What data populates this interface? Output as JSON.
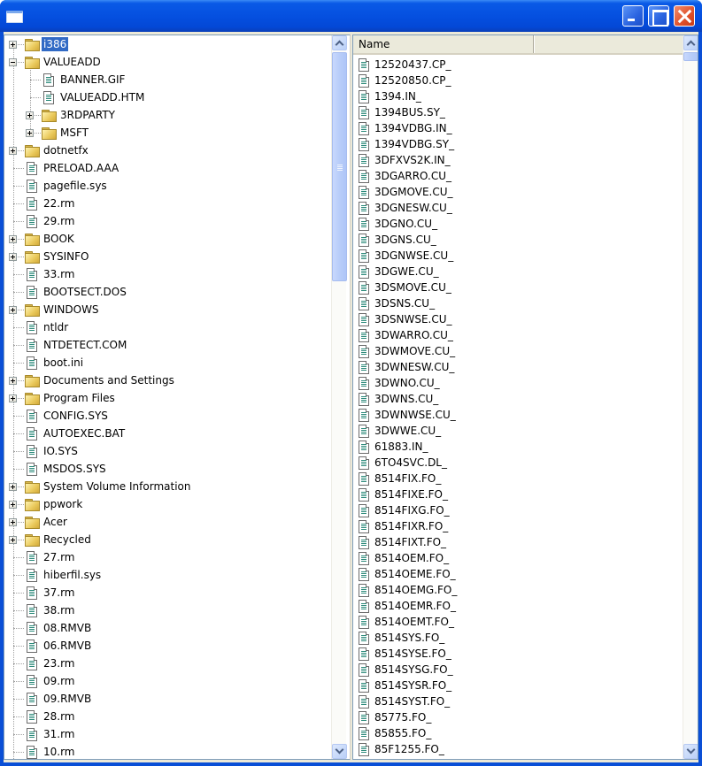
{
  "window": {
    "title": "",
    "buttons": {
      "minimize": "minimize",
      "maximize": "maximize",
      "close": "close"
    }
  },
  "tree": {
    "items": [
      {
        "label": "i386",
        "type": "folder",
        "level": 0,
        "expander": "plus",
        "selected": true
      },
      {
        "label": "VALUEADD",
        "type": "folder",
        "level": 0,
        "expander": "minus"
      },
      {
        "label": "BANNER.GIF",
        "type": "file",
        "level": 1
      },
      {
        "label": "VALUEADD.HTM",
        "type": "file",
        "level": 1
      },
      {
        "label": "3RDPARTY",
        "type": "folder",
        "level": 1,
        "expander": "plus"
      },
      {
        "label": "MSFT",
        "type": "folder",
        "level": 1,
        "expander": "plus"
      },
      {
        "label": "dotnetfx",
        "type": "folder",
        "level": 0,
        "expander": "plus"
      },
      {
        "label": "PRELOAD.AAA",
        "type": "file",
        "level": 0
      },
      {
        "label": "pagefile.sys",
        "type": "file",
        "level": 0
      },
      {
        "label": "22.rm",
        "type": "file",
        "level": 0
      },
      {
        "label": "29.rm",
        "type": "file",
        "level": 0
      },
      {
        "label": "BOOK",
        "type": "folder",
        "level": 0,
        "expander": "plus"
      },
      {
        "label": "SYSINFO",
        "type": "folder",
        "level": 0,
        "expander": "plus"
      },
      {
        "label": "33.rm",
        "type": "file",
        "level": 0
      },
      {
        "label": "BOOTSECT.DOS",
        "type": "file",
        "level": 0
      },
      {
        "label": "WINDOWS",
        "type": "folder",
        "level": 0,
        "expander": "plus"
      },
      {
        "label": "ntldr",
        "type": "file",
        "level": 0
      },
      {
        "label": "NTDETECT.COM",
        "type": "file",
        "level": 0
      },
      {
        "label": "boot.ini",
        "type": "file",
        "level": 0
      },
      {
        "label": "Documents and Settings",
        "type": "folder",
        "level": 0,
        "expander": "plus"
      },
      {
        "label": "Program Files",
        "type": "folder",
        "level": 0,
        "expander": "plus"
      },
      {
        "label": "CONFIG.SYS",
        "type": "file",
        "level": 0
      },
      {
        "label": "AUTOEXEC.BAT",
        "type": "file",
        "level": 0
      },
      {
        "label": "IO.SYS",
        "type": "file",
        "level": 0
      },
      {
        "label": "MSDOS.SYS",
        "type": "file",
        "level": 0
      },
      {
        "label": "System Volume Information",
        "type": "folder",
        "level": 0,
        "expander": "plus"
      },
      {
        "label": "ppwork",
        "type": "folder",
        "level": 0,
        "expander": "plus"
      },
      {
        "label": "Acer",
        "type": "folder",
        "level": 0,
        "expander": "plus"
      },
      {
        "label": "Recycled",
        "type": "folder",
        "level": 0,
        "expander": "plus"
      },
      {
        "label": "27.rm",
        "type": "file",
        "level": 0
      },
      {
        "label": "hiberfil.sys",
        "type": "file",
        "level": 0
      },
      {
        "label": "37.rm",
        "type": "file",
        "level": 0
      },
      {
        "label": "38.rm",
        "type": "file",
        "level": 0
      },
      {
        "label": "08.RMVB",
        "type": "file",
        "level": 0
      },
      {
        "label": "06.RMVB",
        "type": "file",
        "level": 0
      },
      {
        "label": "23.rm",
        "type": "file",
        "level": 0
      },
      {
        "label": "09.rm",
        "type": "file",
        "level": 0
      },
      {
        "label": "09.RMVB",
        "type": "file",
        "level": 0
      },
      {
        "label": "28.rm",
        "type": "file",
        "level": 0
      },
      {
        "label": "31.rm",
        "type": "file",
        "level": 0
      },
      {
        "label": "10.rm",
        "type": "file",
        "level": 0
      }
    ],
    "scrollbar": {
      "thumb_start_fraction": 0.0,
      "thumb_size_fraction": 0.33
    }
  },
  "list": {
    "columns": [
      {
        "label": "Name"
      }
    ],
    "items": [
      "12520437.CP_",
      "12520850.CP_",
      "1394.IN_",
      "1394BUS.SY_",
      "1394VDBG.IN_",
      "1394VDBG.SY_",
      "3DFXVS2K.IN_",
      "3DGARRO.CU_",
      "3DGMOVE.CU_",
      "3DGNESW.CU_",
      "3DGNO.CU_",
      "3DGNS.CU_",
      "3DGNWSE.CU_",
      "3DGWE.CU_",
      "3DSMOVE.CU_",
      "3DSNS.CU_",
      "3DSNWSE.CU_",
      "3DWARRO.CU_",
      "3DWMOVE.CU_",
      "3DWNESW.CU_",
      "3DWNO.CU_",
      "3DWNS.CU_",
      "3DWNWSE.CU_",
      "3DWWE.CU_",
      "61883.IN_",
      "6TO4SVC.DL_",
      "8514FIX.FO_",
      "8514FIXE.FO_",
      "8514FIXG.FO_",
      "8514FIXR.FO_",
      "8514FIXT.FO_",
      "8514OEM.FO_",
      "8514OEME.FO_",
      "8514OEMG.FO_",
      "8514OEMR.FO_",
      "8514OEMT.FO_",
      "8514SYS.FO_",
      "8514SYSE.FO_",
      "8514SYSG.FO_",
      "8514SYSR.FO_",
      "8514SYST.FO_",
      "85775.FO_",
      "85855.FO_",
      "85F1255.FO_"
    ],
    "scrollbar": {
      "thumb_start_fraction": 0.0,
      "thumb_size_fraction": 0.01
    }
  }
}
